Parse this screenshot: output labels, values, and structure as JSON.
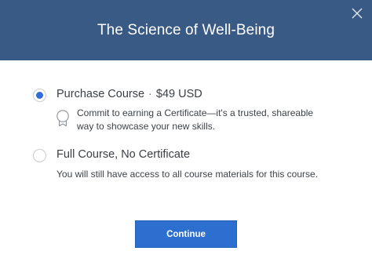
{
  "header": {
    "title": "The Science of Well-Being"
  },
  "options": [
    {
      "title": "Purchase Course",
      "separator": "·",
      "price": "$49 USD",
      "description_line1": "Commit to earning a Certificate—it's a trusted, shareable",
      "description_line2": "way to showcase your new skills.",
      "selected": true
    },
    {
      "title": "Full Course, No Certificate",
      "description": "You will still have access to all course materials for this course.",
      "selected": false
    }
  ],
  "actions": {
    "continue_label": "Continue"
  },
  "colors": {
    "header_bg": "#3a5a86",
    "accent": "#2d6fce",
    "radio_selected": "#2f6ed8"
  },
  "icons": {
    "close": "close-icon",
    "certificate": "certificate-ribbon-icon"
  }
}
